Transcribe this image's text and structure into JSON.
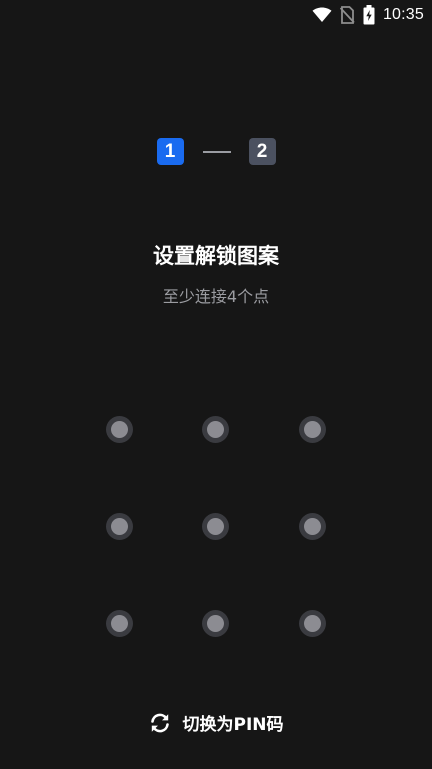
{
  "status_bar": {
    "time": "10:35",
    "icons": [
      "wifi-icon",
      "no-sim-icon",
      "battery-charging-icon"
    ]
  },
  "steps": {
    "step1": "1",
    "step2": "2",
    "active_color": "#1a6bf0",
    "inactive_color": "#4b5160"
  },
  "title": "设置解锁图案",
  "subtitle": "至少连接4个点",
  "pattern": {
    "rows": 3,
    "cols": 3
  },
  "switch_pin": {
    "icon": "refresh-icon",
    "label": "切换为PIN码"
  }
}
